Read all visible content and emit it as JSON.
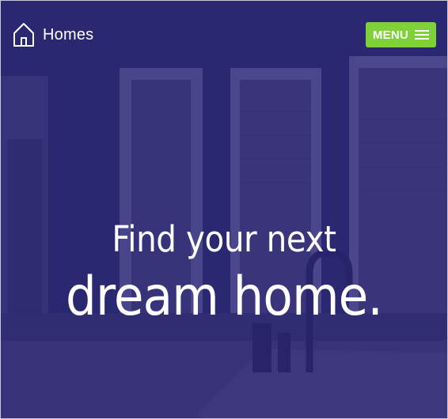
{
  "header": {
    "brand_icon": "home-icon",
    "brand_label": "Homes",
    "menu_label": "MENU",
    "menu_icon": "hamburger-icon"
  },
  "hero": {
    "line1": "Find your next",
    "line2": "dream home."
  },
  "colors": {
    "overlay": "#2c2878",
    "menu_button": "#7ed136",
    "text": "#ffffff"
  }
}
